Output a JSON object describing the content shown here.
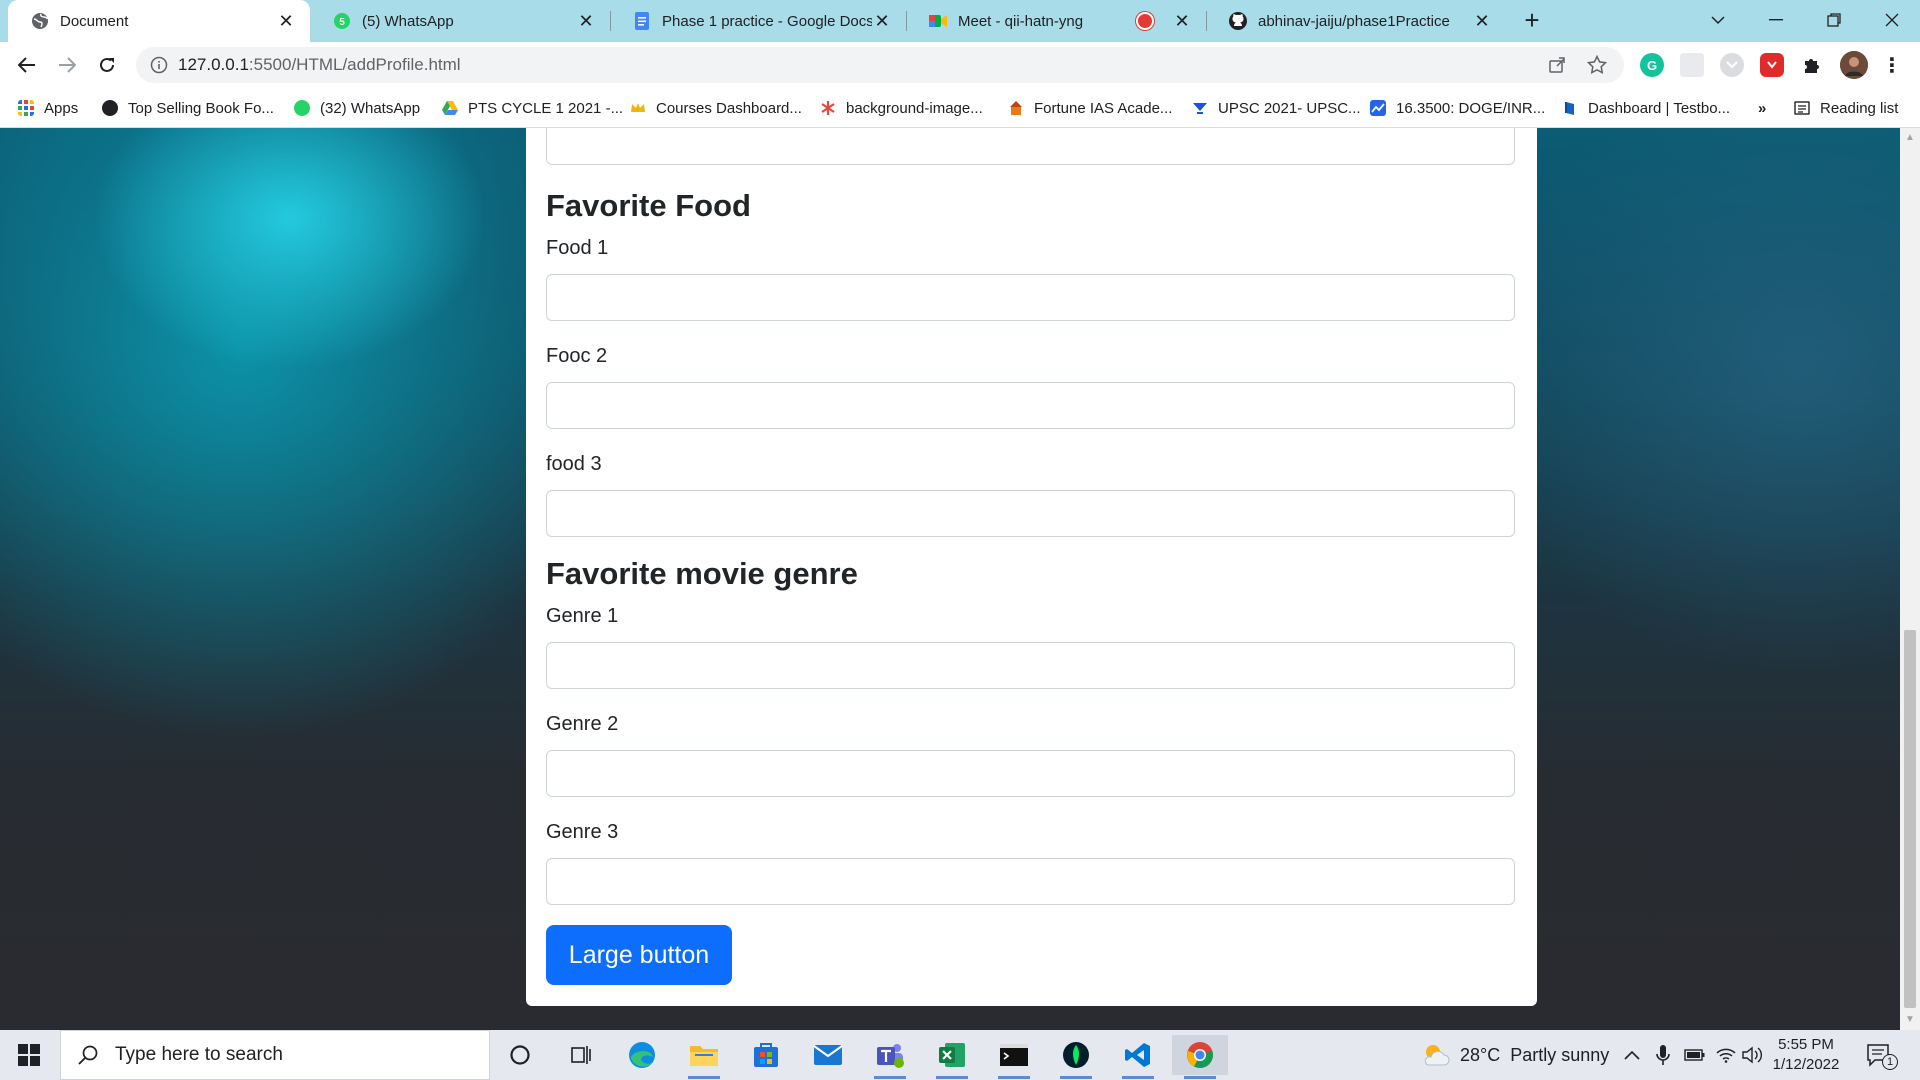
{
  "browser": {
    "tabs": [
      {
        "title": "Document",
        "icon": "globe-icon",
        "active": true
      },
      {
        "title": "(5) WhatsApp",
        "icon": "whatsapp-icon"
      },
      {
        "title": "Phase 1 practice - Google Docs",
        "icon": "google-docs-icon"
      },
      {
        "title": "Meet - qii-hatn-yng",
        "icon": "google-meet-icon",
        "recording": true
      },
      {
        "title": "abhinav-jaiju/phase1Practice",
        "icon": "github-icon"
      }
    ],
    "url_host": "127.0.0.1",
    "url_path": ":5500/HTML/addProfile.html",
    "bookmarks": [
      {
        "label": "Apps",
        "icon": "apps-grid-icon"
      },
      {
        "label": "Top Selling Book Fo...",
        "icon": "book-site-icon"
      },
      {
        "label": "(32) WhatsApp",
        "icon": "whatsapp-icon"
      },
      {
        "label": "PTS CYCLE 1 2021 -...",
        "icon": "google-drive-icon"
      },
      {
        "label": "Courses Dashboard...",
        "icon": "crown-icon"
      },
      {
        "label": "background-image...",
        "icon": "asterisk-icon"
      },
      {
        "label": "Fortune IAS Acade...",
        "icon": "temple-icon"
      },
      {
        "label": "UPSC 2021- UPSC...",
        "icon": "upsc-icon"
      },
      {
        "label": "16.3500: DOGE/INR...",
        "icon": "chart-icon"
      },
      {
        "label": "Dashboard | Testbo...",
        "icon": "testbook-icon"
      }
    ],
    "more_bookmarks": "»",
    "reading_list": "Reading list"
  },
  "page": {
    "food_heading": "Favorite Food",
    "food_fields": [
      {
        "label": "Food 1",
        "value": ""
      },
      {
        "label": "Fooc 2",
        "value": ""
      },
      {
        "label": "food 3",
        "value": ""
      }
    ],
    "genre_heading": "Favorite movie genre",
    "genre_fields": [
      {
        "label": "Genre 1",
        "value": ""
      },
      {
        "label": "Genre 2",
        "value": ""
      },
      {
        "label": "Genre 3",
        "value": ""
      }
    ],
    "submit_label": "Large button"
  },
  "taskbar": {
    "search_placeholder": "Type here to search",
    "apps": [
      "cortana-icon",
      "task-view-icon",
      "edge-icon",
      "file-explorer-icon",
      "microsoft-store-icon",
      "mail-icon",
      "teams-icon",
      "excel-icon",
      "terminal-icon",
      "mongodb-compass-icon",
      "vscode-icon",
      "chrome-icon"
    ],
    "weather": "28°C  Partly sunny",
    "time": "5:55 PM",
    "date": "1/12/2022",
    "notifications": "1"
  },
  "colors": {
    "tabstrip": "#a8dce8",
    "primary_button": "#0d6efd",
    "taskbar": "#e5e8ee"
  }
}
